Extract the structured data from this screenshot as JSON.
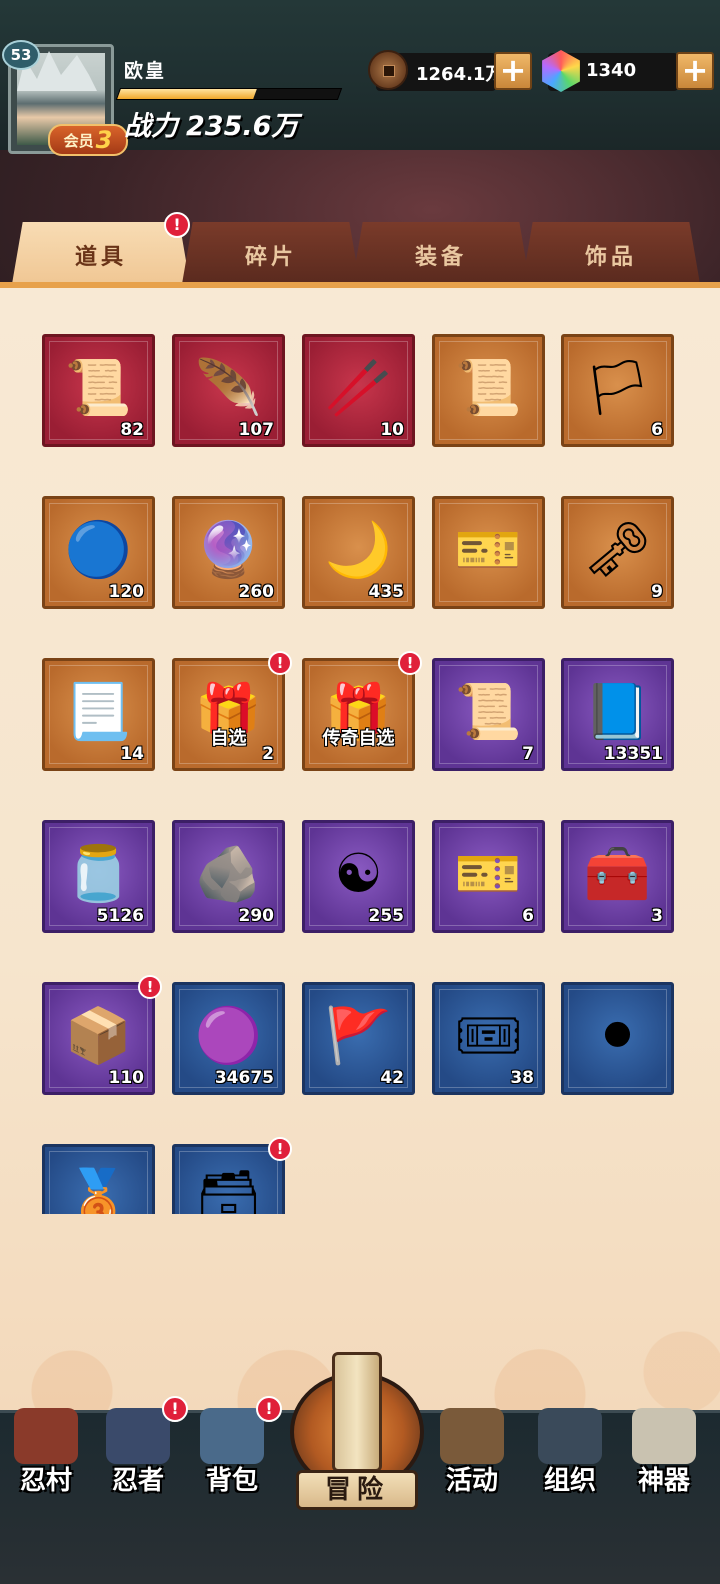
{
  "player": {
    "level": "53",
    "name": "欧皇",
    "vip_label": "会员",
    "vip_level": "3",
    "power_label": "战力",
    "power_value": "235.6万",
    "exp_fraction": 0.62
  },
  "currency": {
    "coins": "1264.1万",
    "gems": "1340",
    "plus": "+"
  },
  "tabs": [
    {
      "label": "道具",
      "active": true,
      "alert": "!"
    },
    {
      "label": "碎片",
      "active": false
    },
    {
      "label": "装备",
      "active": false
    },
    {
      "label": "饰品",
      "active": false
    }
  ],
  "items": [
    {
      "icon": "ninja-scroll-bundle",
      "art": "📜",
      "rarity": "red",
      "count": "82"
    },
    {
      "icon": "flame-feather",
      "art": "🪶",
      "rarity": "red",
      "count": "107"
    },
    {
      "icon": "wooden-stick",
      "art": "🥢",
      "rarity": "red",
      "count": "10"
    },
    {
      "icon": "summon-scroll",
      "art": "📜",
      "rarity": "orange",
      "count": ""
    },
    {
      "icon": "seal-cloth",
      "art": "🏳",
      "rarity": "orange",
      "count": "6"
    },
    {
      "icon": "chakra-orb-blue",
      "art": "🔵",
      "rarity": "orange",
      "count": "120"
    },
    {
      "icon": "chakra-orb-glow",
      "art": "🔮",
      "rarity": "orange",
      "count": "260"
    },
    {
      "icon": "crescent-moon",
      "art": "🌙",
      "rarity": "orange",
      "count": "435"
    },
    {
      "icon": "lucky-ticket",
      "art": "🎫",
      "rarity": "orange",
      "count": ""
    },
    {
      "icon": "bronze-key",
      "art": "🗝",
      "rarity": "orange",
      "count": "9"
    },
    {
      "icon": "paper-talisman",
      "art": "📃",
      "rarity": "orange",
      "count": "14"
    },
    {
      "icon": "gold-chest",
      "art": "🎁",
      "rarity": "orange",
      "count": "2",
      "tag": "自选",
      "alert": "!"
    },
    {
      "icon": "legend-chest",
      "art": "🎁",
      "rarity": "orange",
      "count": "",
      "tag": "传奇自选",
      "alert": "!"
    },
    {
      "icon": "purple-scroll",
      "art": "📜",
      "rarity": "purple",
      "count": "7"
    },
    {
      "icon": "upgrade-book",
      "art": "📘",
      "rarity": "purple",
      "count": "13351"
    },
    {
      "icon": "red-potion-jar",
      "art": "🫙",
      "rarity": "purple",
      "count": "5126"
    },
    {
      "icon": "black-ore",
      "art": "🪨",
      "rarity": "purple",
      "count": "290"
    },
    {
      "icon": "yin-yang-orb",
      "art": "☯",
      "rarity": "purple",
      "count": "255"
    },
    {
      "icon": "lucky-ticket-gold",
      "art": "🎫",
      "rarity": "purple",
      "count": "6"
    },
    {
      "icon": "medical-kit",
      "art": "🧰",
      "rarity": "purple",
      "count": "3"
    },
    {
      "icon": "blue-gift-box",
      "art": "📦",
      "rarity": "purple",
      "count": "110",
      "alert": "!"
    },
    {
      "icon": "purple-orb",
      "art": "🟣",
      "rarity": "blue",
      "count": "34675"
    },
    {
      "icon": "battle-flag-scroll",
      "art": "🚩",
      "rarity": "blue",
      "count": "42"
    },
    {
      "icon": "refresh-ticket",
      "art": "🎟",
      "rarity": "blue",
      "count": "38"
    },
    {
      "icon": "go-board-stones",
      "art": "⚫",
      "rarity": "blue",
      "count": ""
    },
    {
      "icon": "bronze-disc",
      "art": "🥉",
      "rarity": "blue",
      "count": ""
    },
    {
      "icon": "blue-chest",
      "art": "🗃",
      "rarity": "blue",
      "count": "",
      "alert": "!"
    }
  ],
  "nav": [
    {
      "label": "忍村",
      "icon": "village-gate-icon"
    },
    {
      "label": "忍者",
      "icon": "ninja-head-icon",
      "alert": "!"
    },
    {
      "label": "背包",
      "icon": "backpack-icon",
      "alert": "!"
    },
    {
      "label": "冒险",
      "icon": "adventure-scroll-icon"
    },
    {
      "label": "活动",
      "icon": "crossed-kunai-icon"
    },
    {
      "label": "组织",
      "icon": "organization-icon"
    },
    {
      "label": "神器",
      "icon": "artifact-book-icon"
    }
  ],
  "colors": {
    "rarity_red": "#b02a40",
    "rarity_orange": "#c97a38",
    "rarity_purple": "#6f44a6",
    "rarity_blue": "#2e5a9a",
    "alert": "#e0203a"
  }
}
